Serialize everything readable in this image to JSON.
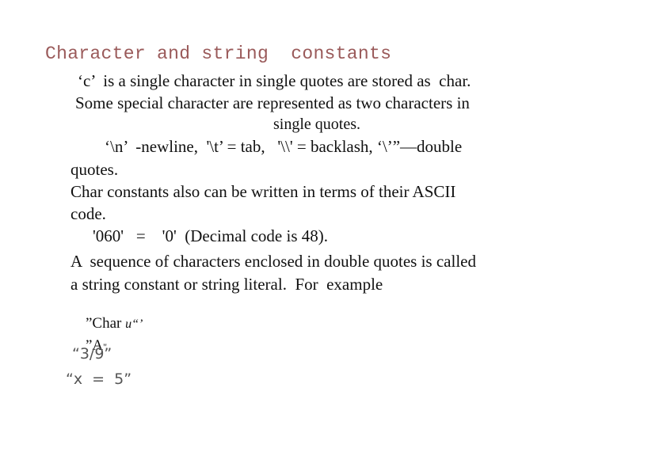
{
  "title": "Character and string  constants",
  "paragraphs": {
    "p1_line1": "‘c’  is a single character in single quotes are stored as  char.",
    "p1_line2": "Some special character are represented as two characters in",
    "p1_line3": "single quotes.",
    "p2_line1": "‘\\n’  -newline,  '\\t’ = tab,   '\\\\' = backlash, ‘\\’”—double",
    "p2_line2": "quotes.",
    "p3_line1": "Char constants also can be written in terms of their ASCII",
    "p3_line2": "code.",
    "p3_line3": "'060'   =    '0'  (Decimal code is 48).",
    "p4_line1": "A  sequence of characters enclosed in double quotes is called",
    "p4_line2": "a string constant or string literal.  For  example"
  },
  "examples": {
    "ex1_main": "”Char ",
    "ex1_tail": "u“’",
    "ex2_main": "”A",
    "ex2_tail": "\"",
    "ex3": "“3/9”",
    "ex4": "“x  =  5”"
  },
  "colors": {
    "title": "#9a5a5a",
    "body_text": "#111111",
    "example_gray": "#555555"
  }
}
